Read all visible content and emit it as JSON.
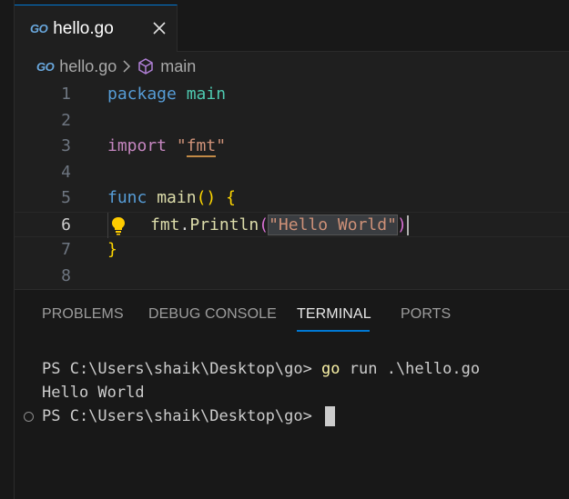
{
  "tab": {
    "icon": "go-icon",
    "icon_text": "GO",
    "label": "hello.go",
    "close_icon": "close-icon"
  },
  "breadcrumb": {
    "file": "hello.go",
    "separator_icon": "chevron-right-icon",
    "symbol_icon": "cube-icon",
    "symbol": "main"
  },
  "editor": {
    "current_line": 6,
    "lines": [
      {
        "n": "1"
      },
      {
        "n": "2"
      },
      {
        "n": "3"
      },
      {
        "n": "4"
      },
      {
        "n": "5"
      },
      {
        "n": "6"
      },
      {
        "n": "7"
      },
      {
        "n": "8"
      }
    ],
    "tokens": {
      "l1_kw": "package",
      "l1_name": "main",
      "l3_kw": "import",
      "l3_q1": "\"",
      "l3_pkg": "fmt",
      "l3_q2": "\"",
      "l5_kw": "func",
      "l5_fn": "main",
      "l5_parens": "()",
      "l5_brace": "{",
      "l6_pkg": "fmt",
      "l6_dot": ".",
      "l6_fn": "Println",
      "l6_open": "(",
      "l6_str": "\"Hello World\"",
      "l6_close": ")",
      "l7_brace": "}"
    },
    "lightbulb_icon": "lightbulb-icon"
  },
  "panel": {
    "tabs": [
      {
        "label": "PROBLEMS"
      },
      {
        "label": "DEBUG CONSOLE"
      },
      {
        "label": "TERMINAL",
        "active": true
      },
      {
        "label": "PORTS"
      }
    ]
  },
  "terminal": {
    "line1_prompt": "PS C:\\Users\\shaik\\Desktop\\go> ",
    "line1_cmd": "go",
    "line1_args": " run .\\hello.go",
    "line2": "Hello World",
    "line3_prompt": "PS C:\\Users\\shaik\\Desktop\\go> "
  },
  "colors": {
    "accent": "#0078d4",
    "keyword": "#569cd6",
    "control_keyword": "#c586c0",
    "string": "#ce9178",
    "function": "#dcdcaa",
    "bracket": "#ffd700",
    "go_logo": "#6aa9df"
  }
}
